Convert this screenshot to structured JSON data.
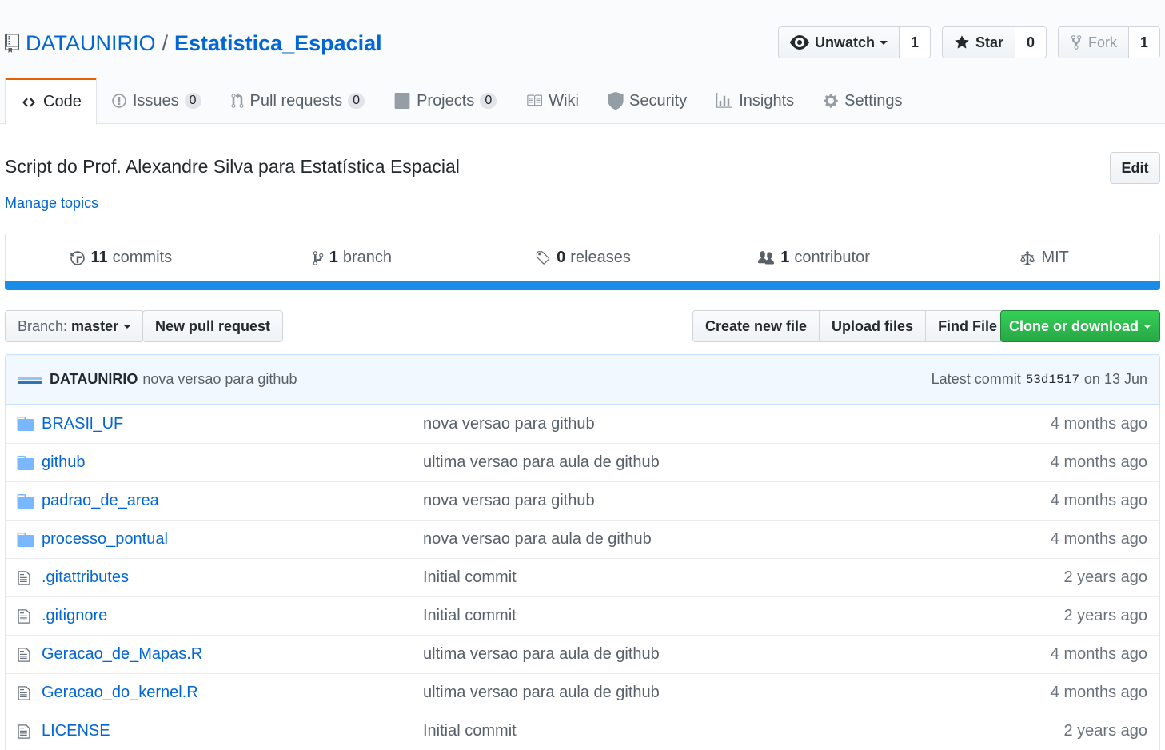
{
  "repo": {
    "owner": "DATAUNIRIO",
    "separator": "/",
    "name": "Estatistica_Espacial",
    "description": "Script do Prof. Alexandre Silva para Estatística Espacial",
    "manage_topics": "Manage topics",
    "edit_label": "Edit"
  },
  "header_actions": {
    "unwatch_label": "Unwatch",
    "watch_count": "1",
    "star_label": "Star",
    "star_count": "0",
    "fork_label": "Fork",
    "fork_count": "1"
  },
  "tabs": [
    {
      "label": "Code",
      "icon": "code-icon",
      "selected": true
    },
    {
      "label": "Issues",
      "icon": "issue-icon",
      "counter": "0"
    },
    {
      "label": "Pull requests",
      "icon": "pull-request-icon",
      "counter": "0"
    },
    {
      "label": "Projects",
      "icon": "project-icon",
      "counter": "0"
    },
    {
      "label": "Wiki",
      "icon": "book-icon"
    },
    {
      "label": "Security",
      "icon": "shield-icon"
    },
    {
      "label": "Insights",
      "icon": "graph-icon"
    },
    {
      "label": "Settings",
      "icon": "gear-icon"
    }
  ],
  "summary": {
    "commits_num": "11",
    "commits_label": "commits",
    "branch_num": "1",
    "branch_label": "branch",
    "releases_num": "0",
    "releases_label": "releases",
    "contributor_num": "1",
    "contributor_label": "contributor",
    "license": "MIT"
  },
  "colors": {
    "language_bar": "#198ce7",
    "clone_button": "#28a745",
    "link": "#0366d6",
    "selected_tab_accent": "#e36209"
  },
  "file_nav": {
    "branch_prefix": "Branch:",
    "branch_name": "master",
    "new_pr": "New pull request",
    "create_file": "Create new file",
    "upload_files": "Upload files",
    "find_file": "Find File",
    "clone": "Clone or download"
  },
  "commit_tease": {
    "author": "DATAUNIRIO",
    "message": "nova versao para github",
    "latest_prefix": "Latest commit",
    "sha": "53d1517",
    "date": "on 13 Jun"
  },
  "files": [
    {
      "type": "dir",
      "icon": "folder-icon",
      "name": "BRASIl_UF",
      "message": "nova versao para github",
      "age": "4 months ago"
    },
    {
      "type": "dir",
      "icon": "folder-icon",
      "name": "github",
      "message": "ultima versao para aula de github",
      "age": "4 months ago"
    },
    {
      "type": "dir",
      "icon": "folder-icon",
      "name": "padrao_de_area",
      "message": "nova versao para github",
      "age": "4 months ago"
    },
    {
      "type": "dir",
      "icon": "folder-icon",
      "name": "processo_pontual",
      "message": "nova versao para aula de github",
      "age": "4 months ago"
    },
    {
      "type": "file",
      "icon": "file-icon",
      "name": ".gitattributes",
      "message": "Initial commit",
      "age": "2 years ago"
    },
    {
      "type": "file",
      "icon": "file-icon",
      "name": ".gitignore",
      "message": "Initial commit",
      "age": "2 years ago"
    },
    {
      "type": "file",
      "icon": "file-icon",
      "name": "Geracao_de_Mapas.R",
      "message": "ultima versao para aula de github",
      "age": "4 months ago"
    },
    {
      "type": "file",
      "icon": "file-icon",
      "name": "Geracao_do_kernel.R",
      "message": "ultima versao para aula de github",
      "age": "4 months ago"
    },
    {
      "type": "file",
      "icon": "file-icon",
      "name": "LICENSE",
      "message": "Initial commit",
      "age": "2 years ago"
    }
  ]
}
